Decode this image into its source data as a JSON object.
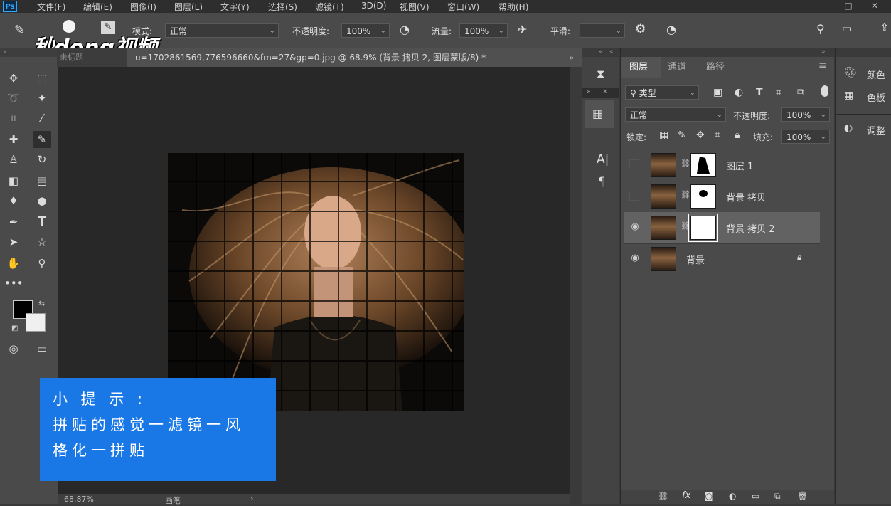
{
  "app": {
    "logo": "Ps"
  },
  "menu": [
    "文件(F)",
    "编辑(E)",
    "图像(I)",
    "图层(L)",
    "文字(Y)",
    "选择(S)",
    "滤镜(T)",
    "3D(D)",
    "视图(V)",
    "窗口(W)",
    "帮助(H)"
  ],
  "watermark": {
    "text": "秒dong视频"
  },
  "options": {
    "mode_label": "模式:",
    "mode_value": "正常",
    "opacity_label": "不透明度:",
    "opacity_value": "100%",
    "flow_label": "流量:",
    "flow_value": "100%",
    "smooth_label": "平滑:"
  },
  "document": {
    "tab_title": "u=1702861569,776596660&fm=27&gp=0.jpg @ 68.9% (背景 拷贝 2, 图层蒙版/8) *",
    "left_tab_fragment": "未标题",
    "zoom": "68.87%",
    "status_text": "画笔"
  },
  "tip": {
    "line1": "小 提 示 :",
    "line2": "拼贴的感觉一滤镜一风",
    "line3": "格化一拼贴"
  },
  "layers_panel": {
    "tabs": [
      "图层",
      "通道",
      "路径"
    ],
    "filter_label": "类型",
    "blend_mode": "正常",
    "opacity_label": "不透明度:",
    "opacity_value": "100%",
    "lock_label": "锁定:",
    "fill_label": "填充:",
    "fill_value": "100%",
    "layers": [
      {
        "name": "图层 1",
        "visible": false,
        "mask": "figure",
        "selected": false
      },
      {
        "name": "背景 拷贝",
        "visible": false,
        "mask": "blob",
        "selected": false
      },
      {
        "name": "背景 拷贝 2",
        "visible": true,
        "mask": "white",
        "selected": true
      },
      {
        "name": "背景",
        "visible": true,
        "mask": "none",
        "selected": false,
        "locked": true
      }
    ]
  },
  "right_panels": [
    {
      "label": "颜色",
      "icon": "palette-icon"
    },
    {
      "label": "色板",
      "icon": "grid-icon"
    },
    {
      "label": "调整",
      "icon": "adjust-icon"
    }
  ],
  "colors": {
    "tip_bg": "#1a78e6",
    "foreground": "#000000",
    "background": "#f0f0f0"
  }
}
